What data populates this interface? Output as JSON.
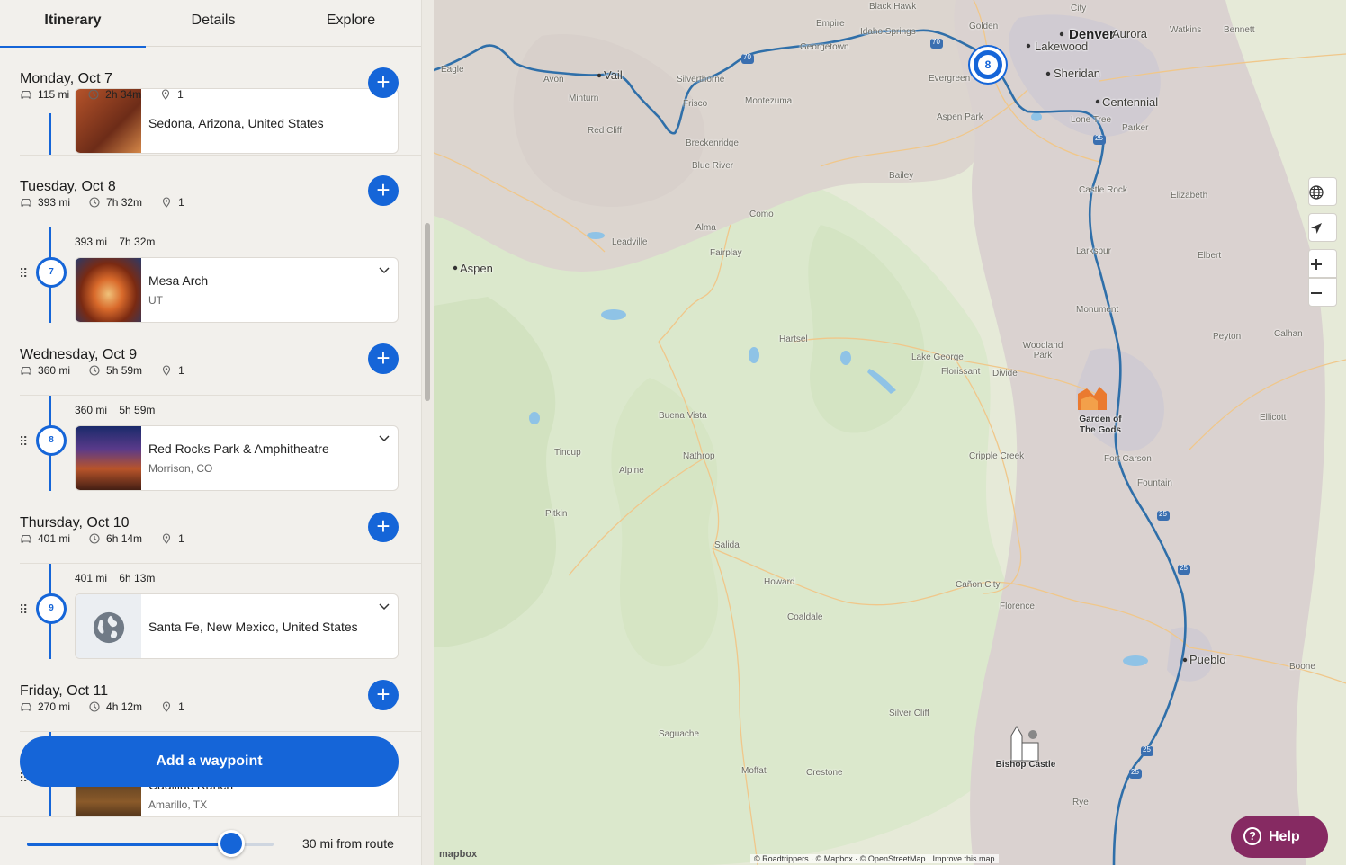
{
  "tabs": [
    {
      "label": "Itinerary"
    },
    {
      "label": "Details"
    },
    {
      "label": "Explore"
    }
  ],
  "days": [
    {
      "title": "Monday, Oct 7",
      "distance": "115 mi",
      "duration": "2h 34m",
      "stops": "1"
    },
    {
      "title": "Tuesday, Oct 8",
      "distance": "393 mi",
      "duration": "7h 32m",
      "stops": "1"
    },
    {
      "title": "Wednesday, Oct 9",
      "distance": "360 mi",
      "duration": "5h 59m",
      "stops": "1"
    },
    {
      "title": "Thursday, Oct 10",
      "distance": "401 mi",
      "duration": "6h 14m",
      "stops": "1"
    },
    {
      "title": "Friday, Oct 11",
      "distance": "270 mi",
      "duration": "4h 12m",
      "stops": "1"
    }
  ],
  "partial_stop_top": {
    "title": "Sedona, Arizona, United States"
  },
  "stops": [
    {
      "leg_distance": "393 mi",
      "leg_duration": "7h 32m",
      "number": "7",
      "title": "Mesa Arch",
      "subtitle": "UT"
    },
    {
      "leg_distance": "360 mi",
      "leg_duration": "5h 59m",
      "number": "8",
      "title": "Red Rocks Park & Amphitheatre",
      "subtitle": "Morrison, CO"
    },
    {
      "leg_distance": "401 mi",
      "leg_duration": "6h 13m",
      "number": "9",
      "title": "Santa Fe, New Mexico, United States",
      "subtitle": ""
    }
  ],
  "partial_stop_bottom": {
    "title": "Cadillac Ranch",
    "subtitle": "Amarillo, TX"
  },
  "add_waypoint_label": "Add a waypoint",
  "route_slider": {
    "label": "30 mi from route",
    "value_fraction": 0.83
  },
  "map": {
    "pin_number": "8",
    "help_label": "Help",
    "attribution": "© Roadtrippers · © Mapbox · © OpenStreetMap · Improve this map",
    "logo": "mapbox",
    "labels": {
      "denver": "Denver",
      "aurora": "Aurora",
      "lakewood": "Lakewood",
      "sheridan": "Sheridan",
      "centennial": "Centennial",
      "pueblo": "Pueblo",
      "aspen": "Aspen",
      "vail": "Vail",
      "golden": "Golden",
      "black_hawk": "Black Hawk",
      "empire": "Empire",
      "idaho_springs": "Idaho Springs",
      "georgetown": "Georgetown",
      "evergreen": "Evergreen",
      "watkins": "Watkins",
      "bennett": "Bennett",
      "city": "City",
      "eagle": "Eagle",
      "avon": "Avon",
      "minturn": "Minturn",
      "silverthorne": "Silverthorne",
      "frisco": "Frisco",
      "montezuma": "Montezuma",
      "aspen_park": "Aspen Park",
      "lone_tree": "Lone Tree",
      "parker": "Parker",
      "red_cliff": "Red Cliff",
      "breckenridge": "Breckenridge",
      "blue_river": "Blue River",
      "bailey": "Bailey",
      "castle_rock": "Castle Rock",
      "elizabeth": "Elizabeth",
      "como": "Como",
      "alma": "Alma",
      "leadville": "Leadville",
      "fairplay": "Fairplay",
      "larkspur": "Larkspur",
      "elbert": "Elbert",
      "monument": "Monument",
      "hartsel": "Hartsel",
      "woodland_park": "Woodland Park",
      "peyton": "Peyton",
      "calhan": "Calhan",
      "lake_george": "Lake George",
      "florissant": "Florissant",
      "divide": "Divide",
      "buena_vista": "Buena Vista",
      "ellicott": "Ellicott",
      "tincup": "Tincup",
      "nathrop": "Nathrop",
      "cripple_creek": "Cripple Creek",
      "fort_carson": "Fort Carson",
      "alpine": "Alpine",
      "fountain": "Fountain",
      "pitkin": "Pitkin",
      "salida": "Salida",
      "howard": "Howard",
      "canon_city": "Cañon City",
      "florence": "Florence",
      "coaldale": "Coaldale",
      "boone": "Boone",
      "silver_cliff": "Silver Cliff",
      "saguache": "Saguache",
      "moffat": "Moffat",
      "crestone": "Crestone",
      "rye": "Rye",
      "garden_of_the_gods": "Garden of The Gods",
      "bishop_castle": "Bishop Castle"
    },
    "highway_labels": {
      "i70a": "70",
      "i70b": "70",
      "i25a": "25",
      "i25b": "25",
      "i25c": "25",
      "i25d": "25",
      "i25e": "25"
    }
  },
  "colors": {
    "accent": "#1565d8",
    "help": "#862a62",
    "route": "#2f6fa9"
  }
}
